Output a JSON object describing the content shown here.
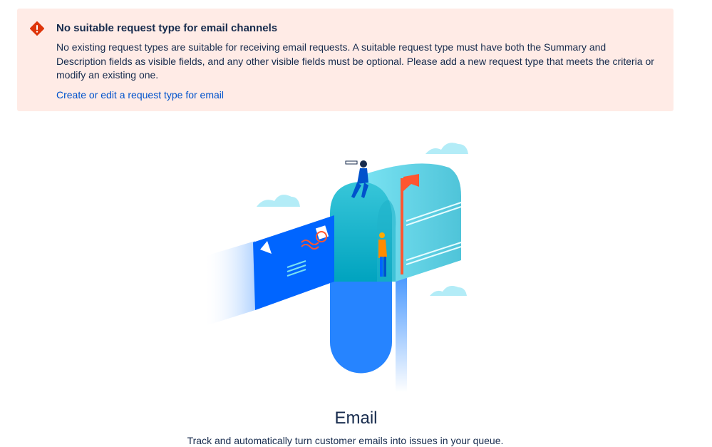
{
  "banner": {
    "title": "No suitable request type for email channels",
    "body": "No existing request types are suitable for receiving email requests. A suitable request type must have both the Summary and Description fields as visible fields, and any other visible fields must be optional. Please add a new request type that meets the criteria or modify an existing one.",
    "link_label": "Create or edit a request type for email",
    "icon": "error-icon",
    "background_color": "#ffebe6",
    "icon_color": "#de350b",
    "link_color": "#0052cc"
  },
  "empty_state": {
    "illustration": "mailbox-illustration",
    "title": "Email",
    "description": "Track and automatically turn customer emails into issues in your queue."
  }
}
